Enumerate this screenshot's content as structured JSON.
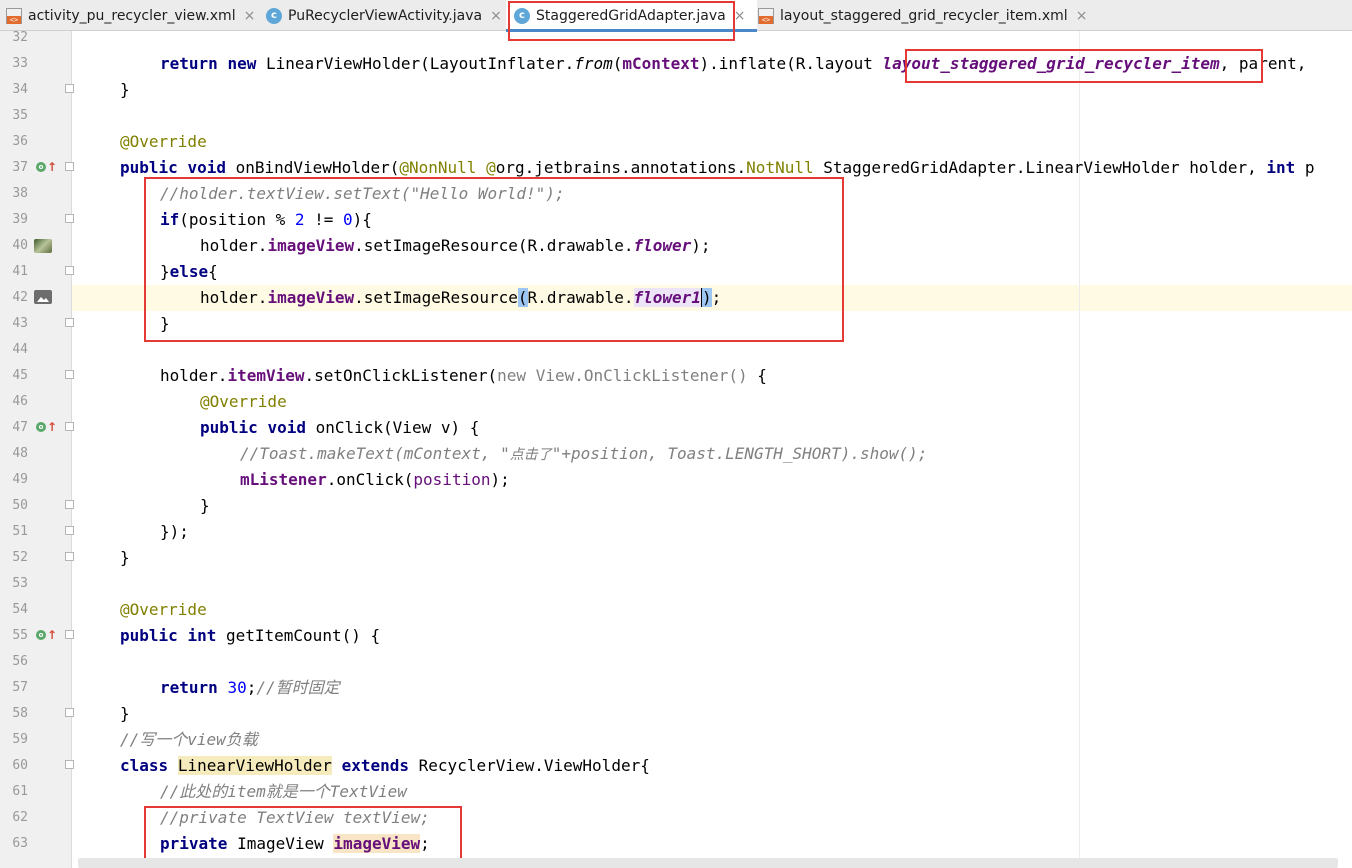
{
  "tabs": [
    {
      "label": "activity_pu_recycler_view.xml",
      "icon": "xml-file-icon"
    },
    {
      "label": "PuRecyclerViewActivity.java",
      "icon": "java-class-icon"
    },
    {
      "label": "StaggeredGridAdapter.java",
      "icon": "java-class-icon",
      "active": true
    },
    {
      "label": "layout_staggered_grid_recycler_item.xml",
      "icon": "xml-file-icon"
    }
  ],
  "close_glyph": "×",
  "class_glyph": "c",
  "line_numbers": [
    "32",
    "33",
    "34",
    "35",
    "36",
    "37",
    "38",
    "39",
    "40",
    "41",
    "42",
    "43",
    "44",
    "45",
    "46",
    "47",
    "48",
    "49",
    "50",
    "51",
    "52",
    "53",
    "54",
    "55",
    "56",
    "57",
    "58",
    "59",
    "60",
    "61",
    "62",
    "63"
  ],
  "code": {
    "l33": [
      "return",
      "new",
      "LinearViewHolder(LayoutInflater.",
      "from",
      "(",
      "mContext",
      ").inflate(R.layout",
      "layout_staggered_grid_recycler_item",
      ", parent,"
    ],
    "l34": "}",
    "l36": "@Override",
    "l37": [
      "public",
      "void",
      "onBindViewHolder(",
      "@NonNull",
      "@",
      "org.jetbrains.annotations.",
      "NotNull",
      "StaggeredGridAdapter.LinearViewHolder holder,",
      "int",
      "p"
    ],
    "l38": "//holder.textView.setText(\"Hello World!\");",
    "l39": [
      "if",
      "(position % ",
      "2",
      " != ",
      "0",
      "){"
    ],
    "l40": [
      "holder.",
      "imageView",
      ".setImageResource(R.drawable.",
      "flower",
      ");"
    ],
    "l41": [
      "}",
      "else",
      "{"
    ],
    "l42": [
      "holder.",
      "imageView",
      ".setImageResource",
      "(",
      "R.drawable.",
      "flower1",
      ")",
      ";"
    ],
    "l43": "}",
    "l45": [
      "holder.",
      "itemView",
      ".setOnClickListener(",
      "new",
      "View.OnClickListener()",
      " {"
    ],
    "l46": "@Override",
    "l47": [
      "public",
      "void",
      "onClick(View v) {"
    ],
    "l48": [
      "//Toast.makeText(mContext, \"",
      "点击了",
      "\"+position, Toast.LENGTH_SHORT).show();"
    ],
    "l49": [
      "mListener",
      ".onClick(",
      "position",
      ");"
    ],
    "l50": "}",
    "l51": "});",
    "l52": "}",
    "l54": "@Override",
    "l55": [
      "public",
      "int",
      "getItemCount() {"
    ],
    "l57": [
      "return",
      "30",
      ";",
      "//暂时固定"
    ],
    "l58": "}",
    "l59": "//写一个view负载",
    "l60": [
      "class",
      "LinearViewHolder",
      "extends",
      "RecyclerView.ViewHolder{"
    ],
    "l61": "//此处的item就是一个TextView",
    "l62": "//private TextView textView;",
    "l63": [
      "private",
      "ImageView",
      "imageView",
      ";"
    ]
  },
  "colors": {
    "keyword": "#000080",
    "annotation": "#808000",
    "number": "#0000ff",
    "comment": "#808080",
    "field": "#660e7a",
    "highlight_box": "#e53935",
    "caret_line": "#fffae3"
  }
}
